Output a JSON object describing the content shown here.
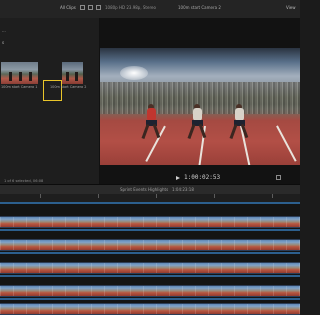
{
  "toolbar": {
    "clips_menu": "All Clips",
    "format": "1080p HD 23.98p, Stereo",
    "viewer_title": "100m start Camera 2",
    "view_menu": "View"
  },
  "browser": {
    "side_items": [
      "...",
      "s"
    ],
    "clips": [
      {
        "name": "100m start Camera 1"
      },
      {
        "name": "100m start Camera 2"
      }
    ],
    "status": "1 of 6 selected, 06:08"
  },
  "viewer": {
    "timecode": "1:00:02:53"
  },
  "timeline": {
    "title": "Sprint Events Highlights",
    "duration": "1:04:23:18"
  },
  "colors": {
    "selection": "#e9c52a",
    "track_blue": "#2c5f8e"
  }
}
